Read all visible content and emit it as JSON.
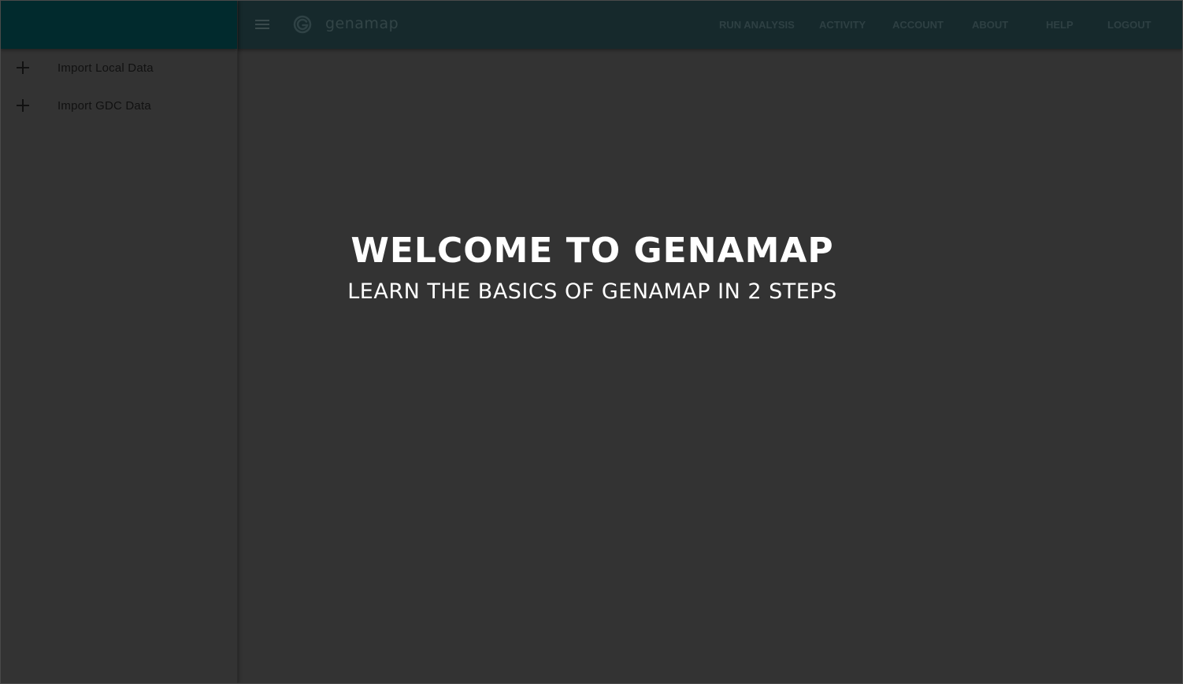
{
  "app": {
    "logo_text": "genamap",
    "logo_icon": "genamap-g-logo-icon"
  },
  "colors": {
    "sidebar_header": "#012a2d",
    "topbar": "#16292c",
    "background": "#333333",
    "nav_text": "#2e4043",
    "welcome_text": "#ffffff"
  },
  "sidebar": {
    "items": [
      {
        "icon": "plus-icon",
        "label": "Import Local Data"
      },
      {
        "icon": "plus-icon",
        "label": "Import GDC Data"
      }
    ]
  },
  "topbar": {
    "menu_icon": "hamburger-menu-icon",
    "nav": [
      {
        "label": "RUN ANALYSIS"
      },
      {
        "label": "ACTIVITY"
      },
      {
        "label": "ACCOUNT"
      },
      {
        "label": "ABOUT"
      },
      {
        "label": "HELP"
      },
      {
        "label": "LOGOUT"
      }
    ]
  },
  "welcome": {
    "title": "WELCOME TO GENAMAP",
    "subtitle": "LEARN THE BASICS OF GENAMAP IN 2 STEPS"
  }
}
